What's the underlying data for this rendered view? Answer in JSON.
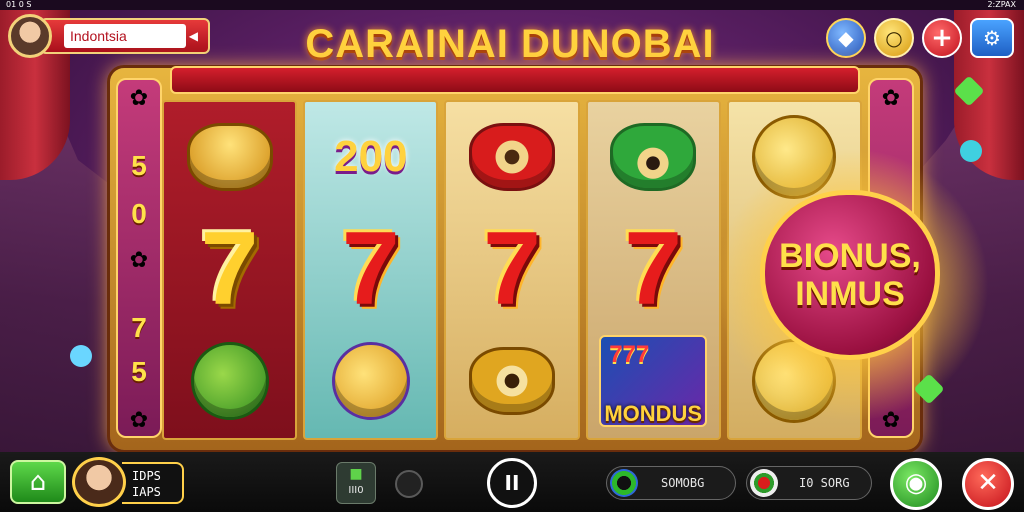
{
  "status": {
    "left": "01 0 S",
    "right": "2:ZPAX"
  },
  "region": {
    "label": "Indontsia"
  },
  "title": "CARAINAI DUNOBAI",
  "top_icons": [
    "coin-icon",
    "gem-icon",
    "plus-icon",
    "settings-icon"
  ],
  "side_numbers": [
    "5",
    "0",
    "7",
    "5"
  ],
  "reels": [
    {
      "symbols": [
        "bowl",
        "7",
        "horn"
      ]
    },
    {
      "symbols": [
        "200",
        "7",
        "bell"
      ]
    },
    {
      "symbols": [
        "eye",
        "7",
        "eye"
      ]
    },
    {
      "symbols": [
        "eye",
        "7",
        "MONDUS"
      ]
    },
    {
      "symbols": [
        "coin",
        "BONUS",
        "coin"
      ]
    }
  ],
  "reel_text": {
    "r2_top": "200",
    "seven": "7",
    "mondus_777": "777",
    "mondus": "MONDUS"
  },
  "bonus": {
    "line1": "BIONUS,",
    "line2": "INMUS"
  },
  "bottom": {
    "player_line1": "IDPS",
    "player_line2": "IAPS",
    "small_btn": "III0",
    "pause": "II",
    "pill1": "SOMOBG",
    "pill2": "I0 SORG",
    "home_icon": "home-icon",
    "confirm_icon": "gamepad-icon",
    "close_icon": "close-icon"
  }
}
